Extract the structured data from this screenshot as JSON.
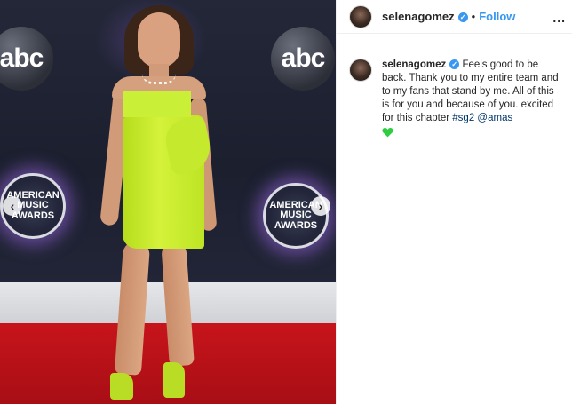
{
  "post": {
    "username": "selenagomez",
    "follow_label": "Follow",
    "separator": "•",
    "more_label": "...",
    "verified_mark": "✓"
  },
  "photo": {
    "backdrop_logo": "abc",
    "award_line1": "AMERICAN",
    "award_line2": "MUSIC",
    "award_line3": "AWARDS",
    "prev_arrow": "‹",
    "next_arrow": "›"
  },
  "caption": {
    "username": "selenagomez",
    "text": "Feels good to be back. Thank you to my entire team and to my fans that stand by me. All of this is for you and because of you. excited for this chapter",
    "hashtag": "#sg2",
    "mention": "@amas",
    "emoji": "green-heart"
  },
  "colors": {
    "link": "#3897f0",
    "hashtag": "#003569",
    "heart": "#2ecc40",
    "dress": "#c9ef37",
    "carpet": "#c7141b"
  }
}
